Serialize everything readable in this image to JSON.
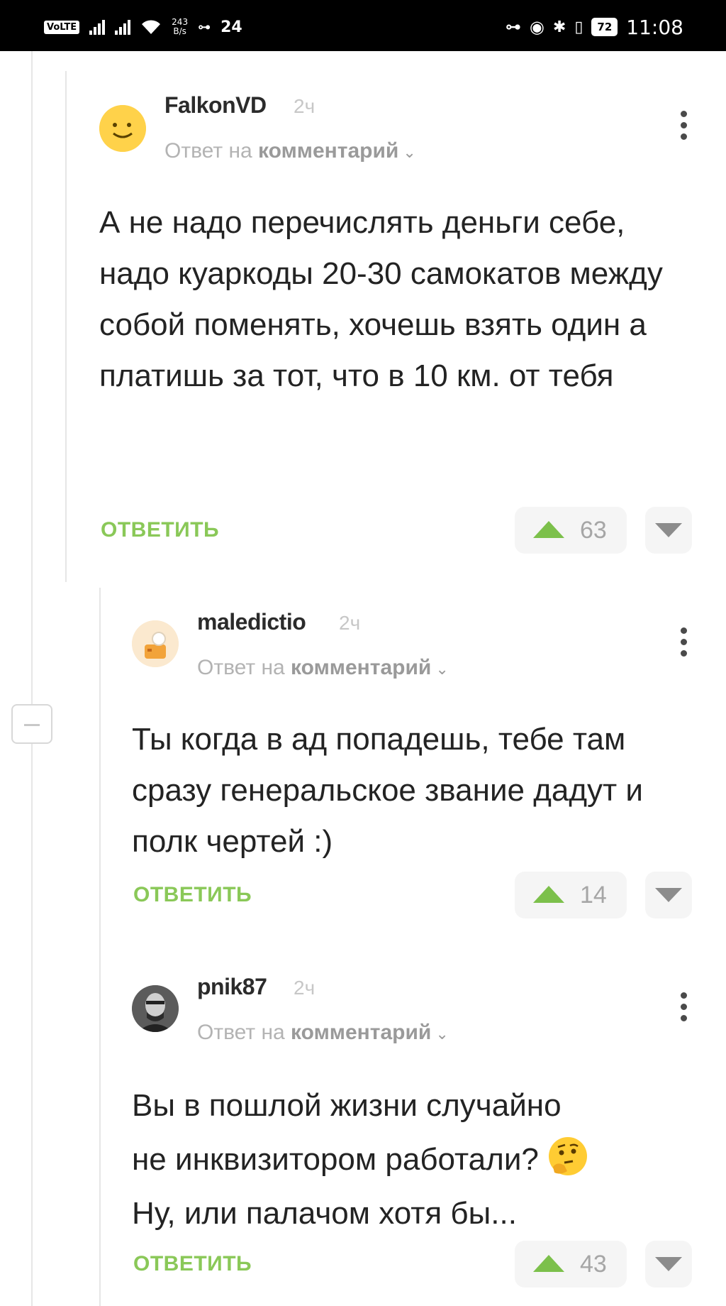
{
  "status_bar": {
    "carrier_badge": "VoLTE",
    "net_speed_value": "243",
    "net_speed_unit": "B/s",
    "notification_count": "24",
    "battery": "72",
    "time": "11:08"
  },
  "comments": [
    {
      "username": "FalkonVD",
      "time": "2ч",
      "reply_prefix": "Ответ на",
      "reply_target": "комментарий",
      "text": "А не надо перечислять деньги себе, надо куаркоды 20-30 самокатов между собой поменять, хочешь взять один а платишь за тот, что в 10 км. от тебя",
      "reply_label": "ОТВЕТИТЬ",
      "votes": "63",
      "avatar_icon": "smiley-face-icon"
    },
    {
      "username": "maledictio",
      "time": "2ч",
      "reply_prefix": "Ответ на",
      "reply_target": "комментарий",
      "text": "Ты когда в ад попадешь, тебе там сразу генеральское звание дадут и полк чертей :)",
      "reply_label": "ОТВЕТИТЬ",
      "votes": "14",
      "avatar_icon": "cartoon-avatar-icon"
    },
    {
      "username": "pnik87",
      "time": "2ч",
      "reply_prefix": "Ответ на",
      "reply_target": "комментарий",
      "text_line1": "Вы в пошлой жизни случайно",
      "text_line2": "не инквизитором работали?",
      "text_line3": "Ну, или палачом хотя бы...",
      "emoji": "thinking-face-icon",
      "reply_label": "ОТВЕТИТЬ",
      "votes": "43",
      "avatar_icon": "user-photo-icon"
    }
  ],
  "colors": {
    "accent_green": "#8ac858",
    "upvote_green": "#7cc04b",
    "text": "#232323"
  }
}
